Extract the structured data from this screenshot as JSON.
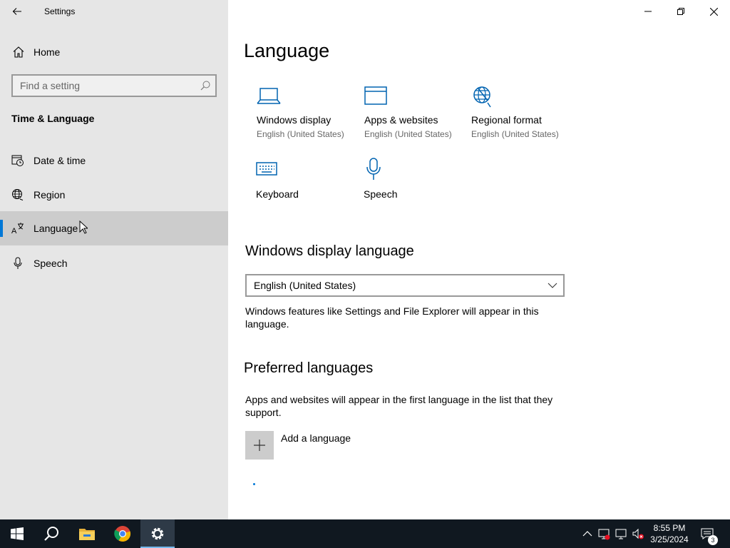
{
  "window": {
    "title": "Settings",
    "controls": {
      "minimize": "minimize",
      "restore": "restore",
      "close": "close"
    }
  },
  "sidebar": {
    "home_label": "Home",
    "search_placeholder": "Find a setting",
    "section_title": "Time & Language",
    "items": [
      {
        "label": "Date & time",
        "icon": "clock-calendar-icon",
        "selected": false
      },
      {
        "label": "Region",
        "icon": "globe-icon",
        "selected": false
      },
      {
        "label": "Language",
        "icon": "language-icon",
        "selected": true
      },
      {
        "label": "Speech",
        "icon": "microphone-icon",
        "selected": false
      }
    ]
  },
  "main": {
    "title": "Language",
    "tiles": [
      {
        "name": "Windows display",
        "sub": "English (United States)",
        "icon": "laptop-icon"
      },
      {
        "name": "Apps & websites",
        "sub": "English (United States)",
        "icon": "browser-window-icon"
      },
      {
        "name": "Regional format",
        "sub": "English (United States)",
        "icon": "globe-settings-icon"
      },
      {
        "name": "Keyboard",
        "sub": "",
        "icon": "keyboard-icon"
      },
      {
        "name": "Speech",
        "sub": "",
        "icon": "microphone-icon"
      }
    ],
    "display_language": {
      "heading": "Windows display language",
      "selected": "English (United States)",
      "description": "Windows features like Settings and File Explorer will appear in this language."
    },
    "preferred": {
      "heading": "Preferred languages",
      "description": "Apps and websites will appear in the first language in the list that they support.",
      "add_label": "Add a language"
    }
  },
  "taskbar": {
    "apps": [
      "start-icon",
      "search-icon",
      "file-explorer-icon",
      "chrome-icon",
      "settings-icon"
    ],
    "active_app": "settings-icon",
    "tray": [
      "chevron-up-icon",
      "network-warning-icon",
      "monitor-icon",
      "volume-muted-icon"
    ],
    "time": "8:55 PM",
    "date": "3/25/2024",
    "notification_count": "3"
  },
  "colors": {
    "accent": "#0078d7",
    "sidebar_bg": "#e6e6e6",
    "taskbar_bg": "#101820"
  }
}
